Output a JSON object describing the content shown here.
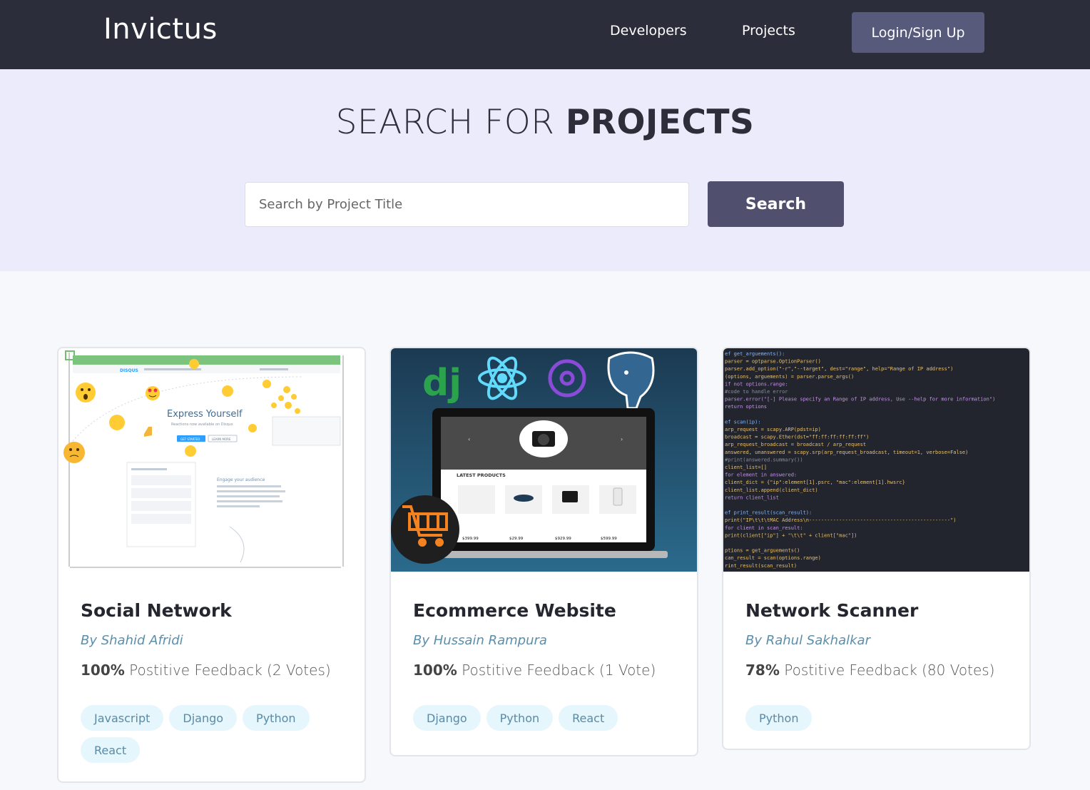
{
  "header": {
    "logo": "Invictus",
    "nav": {
      "developers": "Developers",
      "projects": "Projects"
    },
    "login_label": "Login/Sign Up"
  },
  "hero": {
    "title_light": "SEARCH FOR ",
    "title_bold": "PROJECTS",
    "search_placeholder": "Search by Project Title",
    "search_button": "Search"
  },
  "projects": [
    {
      "title": "Social Network",
      "author": "By Shahid Afridi",
      "percent": "100%",
      "feedback": " Postitive Feedback (2 Votes)",
      "tags": [
        "Javascript",
        "Django",
        "Python",
        "React"
      ],
      "thumb": {
        "brand": "DISQUS",
        "headline": "Express Yourself",
        "subline": "Reactions now available on Disqus",
        "cta1": "GET STARTED",
        "cta2": "LEARN MORE",
        "section": "Engage your audience"
      }
    },
    {
      "title": "Ecommerce Website",
      "author": "By Hussain Rampura",
      "percent": "100%",
      "feedback": " Postitive Feedback (1 Vote)",
      "tags": [
        "Django",
        "Python",
        "React"
      ],
      "thumb": {
        "django": "dj",
        "section": "LATEST PRODUCTS",
        "prices": [
          "$399.99",
          "$29.99",
          "$929.99",
          "$599.99"
        ]
      }
    },
    {
      "title": "Network Scanner",
      "author": "By Rahul Sakhalkar",
      "percent": "78%",
      "feedback": " Postitive Feedback (80 Votes)",
      "tags": [
        "Python"
      ],
      "thumb": {
        "code": [
          "ef get_arguements():",
          "   parser = optparse.OptionParser()",
          "   parser.add_option(\"-r\",\"--target\", dest=\"range\", help=\"Range of IP address\")",
          "   (options, arguements) = parser.parse_args()",
          "   if not options.range:",
          "       #code to handle error",
          "       parser.error(\"[-] Please specify an Range of IP address, Use --help for more information\")",
          "   return options",
          "",
          "ef scan(ip):",
          "   arp_request = scapy.ARP(pdst=ip)",
          "   broadcast = scapy.Ether(dst=\"ff:ff:ff:ff:ff:ff\")",
          "   arp_request_broadcast = broadcast / arp_request",
          "   answered, unanswered = scapy.srp(arp_request_broadcast, timeout=1, verbose=False)",
          "   #print(answered.summary())",
          "   client_list=[]",
          "   for element in answered:",
          "       client_dict = {\"ip\":element[1].psrc, \"mac\":element[1].hwsrc}",
          "       client_list.append(client_dict)",
          "   return client_list",
          "",
          "ef print_result(scan_result):",
          "   print(\"IP\\t\\t\\tMAC Address\\n-----------------------------------------------\")",
          "   for client in scan_result:",
          "       print(client[\"ip\"] + \"\\t\\t\" + client[\"mac\"])",
          "",
          "ptions = get_arguements()",
          "can_result = scan(options.range)",
          "rint_result(scan_result)"
        ]
      }
    }
  ],
  "colors": {
    "header_bg": "#2c2d3a",
    "hero_bg": "#ecebfb",
    "button_bg": "#50506e",
    "tag_bg": "#e5f6fc",
    "tag_text": "#5a8aa5",
    "author_text": "#5b8eab"
  }
}
